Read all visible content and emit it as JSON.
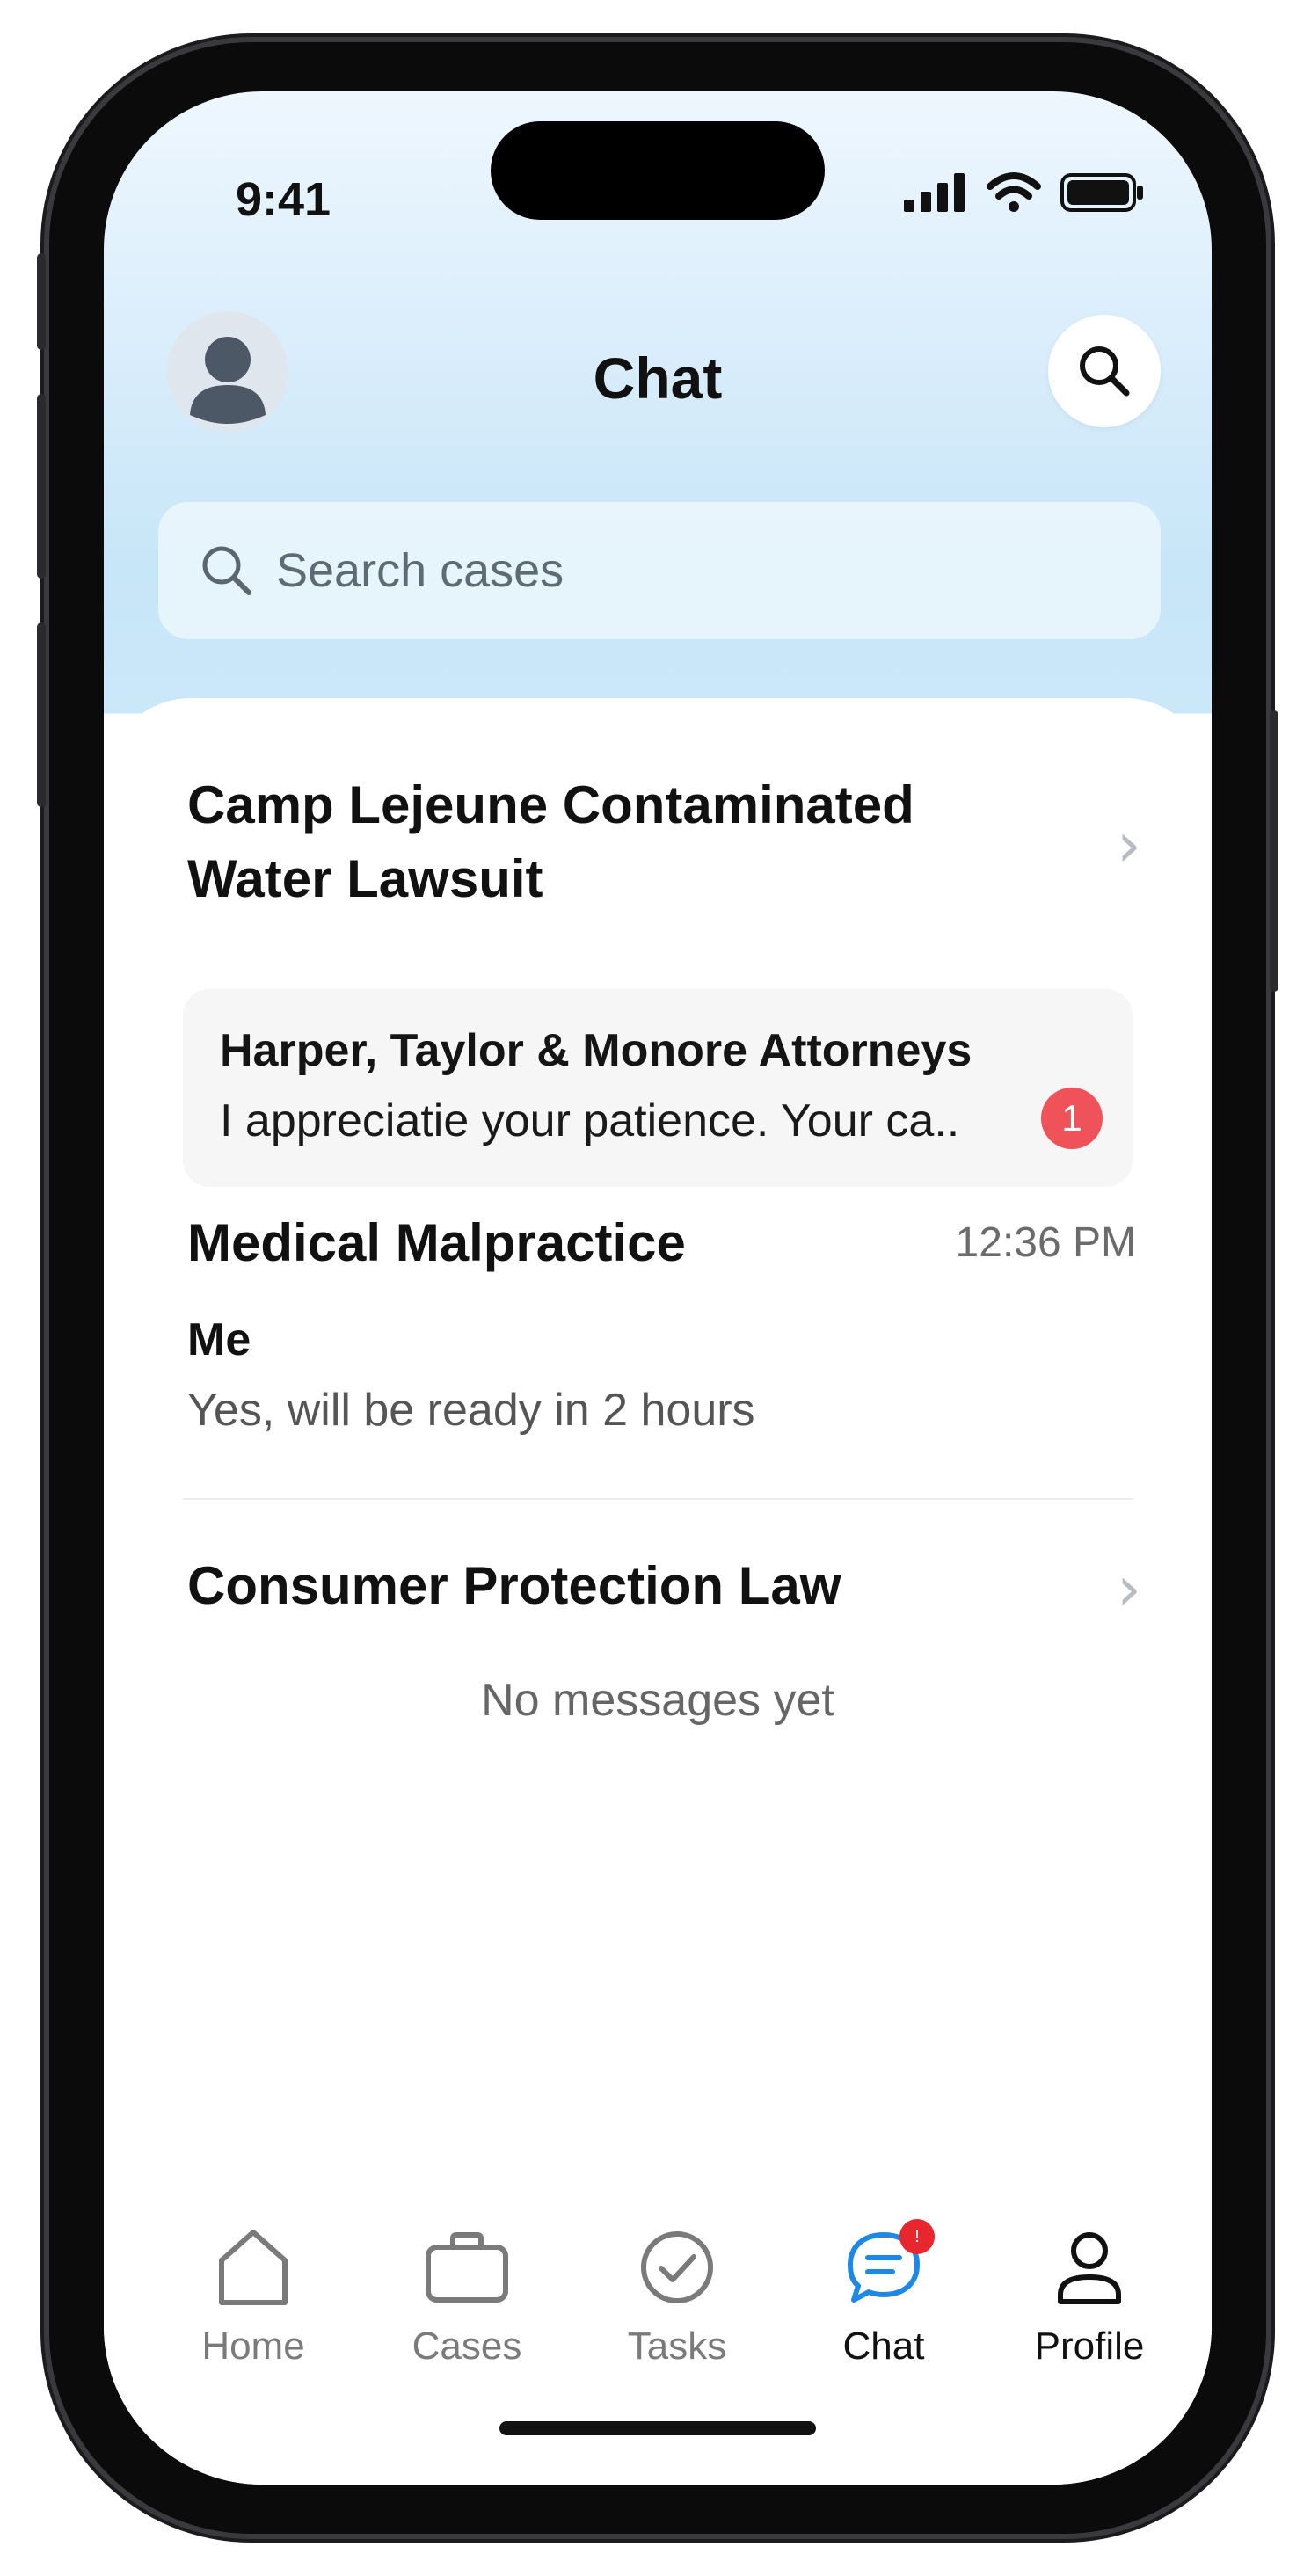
{
  "status_bar": {
    "time": "9:41",
    "icons": [
      "signal-icon",
      "wifi-icon",
      "battery-icon"
    ]
  },
  "header": {
    "title": "Chat",
    "avatar_icon": "user-avatar-icon",
    "search_icon": "search-icon"
  },
  "search": {
    "placeholder": "Search cases"
  },
  "cases": [
    {
      "title": "Camp Lejeune Contaminated Water Lawsuit",
      "sender": "Harper, Taylor & Monore Attorneys",
      "preview": "I appreciatie your patience. Your ca..",
      "unread": "1"
    },
    {
      "title": "Medical Malpractice",
      "time": "12:36 PM",
      "sender": "Me",
      "preview": "Yes, will be ready in 2 hours"
    },
    {
      "title": "Consumer Protection Law",
      "empty_text": "No messages yet"
    }
  ],
  "tabs": [
    {
      "label": "Home",
      "icon": "home-icon"
    },
    {
      "label": "Cases",
      "icon": "briefcase-icon"
    },
    {
      "label": "Tasks",
      "icon": "check-circle-icon"
    },
    {
      "label": "Chat",
      "icon": "chat-bubble-icon",
      "badge": "!"
    },
    {
      "label": "Profile",
      "icon": "person-icon"
    }
  ],
  "colors": {
    "accent": "#1e88e5",
    "badge": "#f0525a",
    "tab_badge": "#e8262e"
  }
}
